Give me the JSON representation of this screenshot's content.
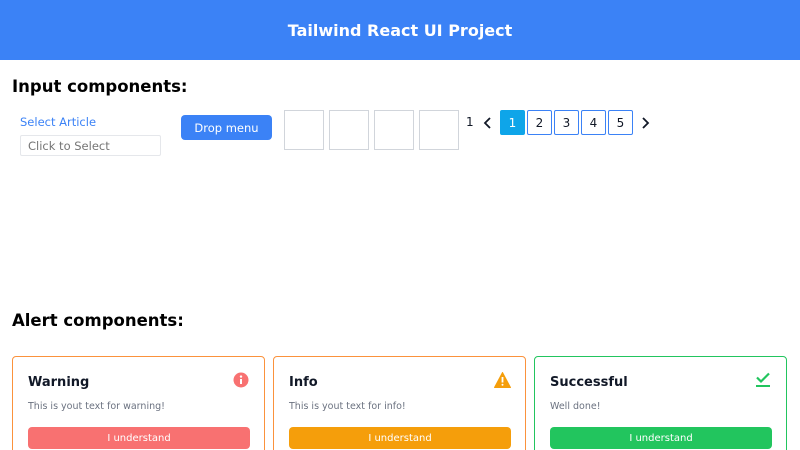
{
  "header": {
    "title": "Tailwind React UI Project"
  },
  "input_section": {
    "title": "Input components:",
    "select": {
      "label": "Select Article",
      "placeholder": "Click to Select"
    },
    "drop_menu_label": "Drop menu",
    "box_count": "1",
    "pagination": {
      "pages": [
        "1",
        "2",
        "3",
        "4",
        "5"
      ],
      "active": "1"
    }
  },
  "alert_section": {
    "title": "Alert components:",
    "cards": [
      {
        "title": "Warning",
        "text": "This is yout text for warning!",
        "button": "I understand",
        "icon": "info-icon",
        "accent": "#f87171"
      },
      {
        "title": "Info",
        "text": "This is yout text for info!",
        "button": "I understand",
        "icon": "warning-triangle-icon",
        "accent": "#f59e0b"
      },
      {
        "title": "Successful",
        "text": "Well done!",
        "button": "I understand",
        "icon": "check-icon",
        "accent": "#22c55e"
      }
    ]
  },
  "colors": {
    "primary": "#3b82f6",
    "active_page": "#0ea5e9"
  }
}
